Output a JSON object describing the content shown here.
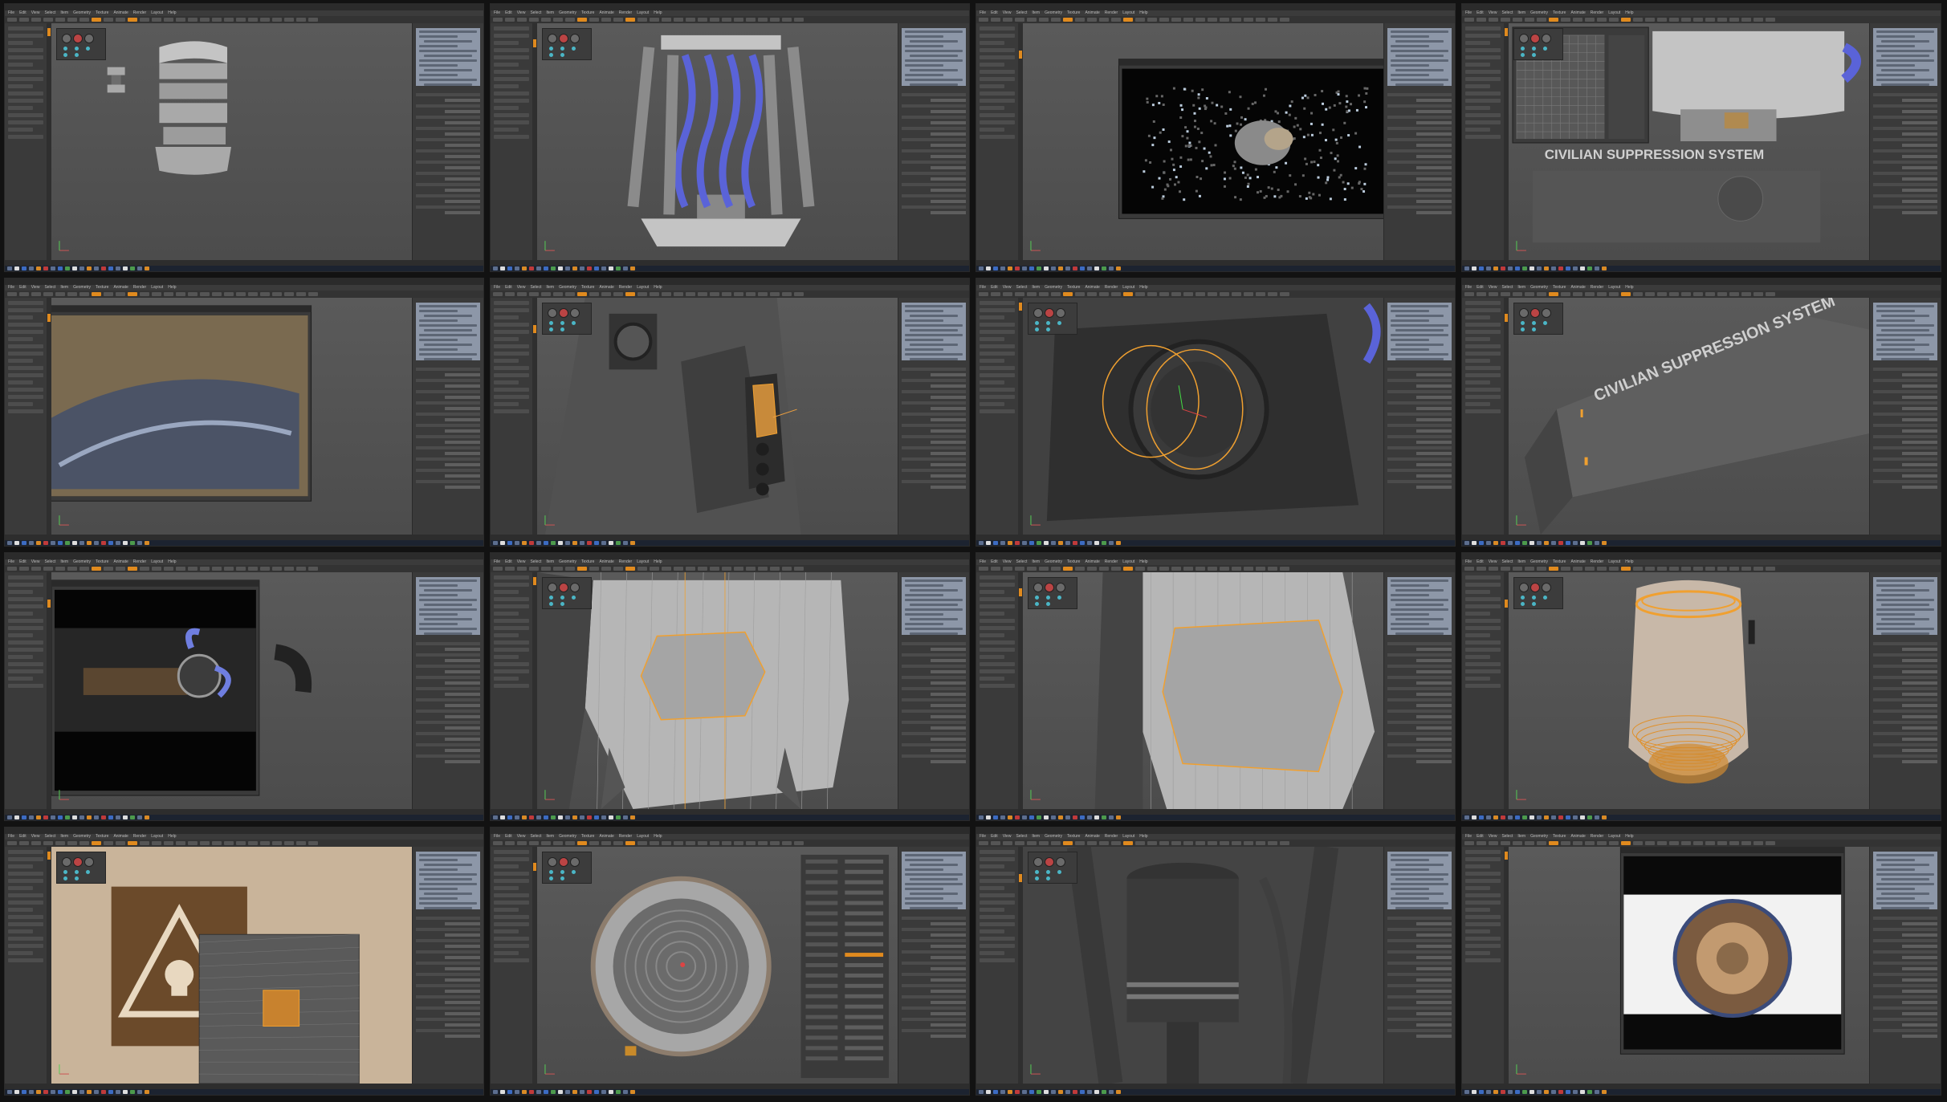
{
  "collage": {
    "columns": 4,
    "rows": 4
  },
  "ui": {
    "menu_labels": [
      "File",
      "Edit",
      "View",
      "Select",
      "Item",
      "Geometry",
      "Texture",
      "Animate",
      "Render",
      "Layout",
      "Help"
    ],
    "accent_color": "#e08a1e",
    "selection_color": "#f0a030",
    "itemlist_color": "#8d97a8"
  },
  "scenes": [
    {
      "id": "s1",
      "scene": "column-pieces"
    },
    {
      "id": "s2",
      "scene": "hexapod-legs-blue-spiral"
    },
    {
      "id": "s3",
      "scene": "preview-render-window-noisy"
    },
    {
      "id": "s4",
      "scene": "civilian-suppression-system-uv-window"
    },
    {
      "id": "s5",
      "scene": "preview-render-window-metal-closeup"
    },
    {
      "id": "s6",
      "scene": "speaker-panel-orange-selection"
    },
    {
      "id": "s7",
      "scene": "orange-ring-selection"
    },
    {
      "id": "s8",
      "scene": "civilian-suppression-system-text"
    },
    {
      "id": "s9",
      "scene": "preview-render-window-weapon"
    },
    {
      "id": "s10",
      "scene": "hex-cut-mesh-wireframe"
    },
    {
      "id": "s11",
      "scene": "hex-cut-mesh-closeup"
    },
    {
      "id": "s12",
      "scene": "canister-orange-rings"
    },
    {
      "id": "s13",
      "scene": "hazard-decal-skull"
    },
    {
      "id": "s14",
      "scene": "cylinder-topdown"
    },
    {
      "id": "s15",
      "scene": "piston-cylinder"
    },
    {
      "id": "s16",
      "scene": "preview-render-window-spherical"
    }
  ],
  "texts": {
    "civilian_suppression_system": "CIVILIAN SUPPRESSION SYSTEM"
  }
}
